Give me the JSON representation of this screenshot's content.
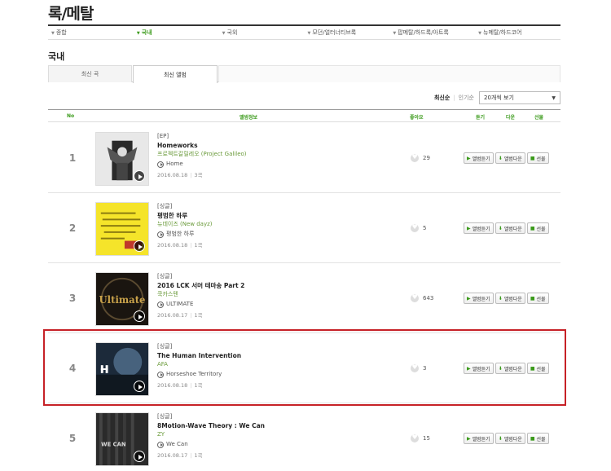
{
  "page_title": "록/메탈",
  "genre_nav": [
    "종합",
    "국내",
    "국외",
    "모던/얼터너티브록",
    "팝메탈/하드록/아트록",
    "뉴메탈/하드코어"
  ],
  "section_title": "국내",
  "tabs": [
    "최신 곡",
    "최신 앨범"
  ],
  "sort": {
    "newest": "최신순",
    "popular": "인기순",
    "view_select": "20개씩 보기"
  },
  "table_head": {
    "no": "No",
    "album_info": "앨범정보",
    "like": "좋아요",
    "listen": "듣기",
    "download": "다운",
    "gift": "선물"
  },
  "buttons": {
    "listen": "앨범듣기",
    "download": "앨범다운",
    "gift": "선물"
  },
  "albums": [
    {
      "no": "1",
      "type": "[EP]",
      "title": "Homeworks",
      "artist": "프로젝트갈릴레오 (Project Galileo)",
      "track": "Home",
      "date": "2016.08.18",
      "count": "3곡",
      "likes": "29"
    },
    {
      "no": "2",
      "type": "[싱글]",
      "title": "평범한 하루",
      "artist": "뉴데이즈 (New dayz)",
      "track": "평범한 하루",
      "date": "2016.08.18",
      "count": "1곡",
      "likes": "5"
    },
    {
      "no": "3",
      "type": "[싱글]",
      "title": "2016 LCK 서머 테마송 Part 2",
      "artist": "쿡카스텐",
      "track": "ULTIMATE",
      "date": "2016.08.17",
      "count": "1곡",
      "likes": "643"
    },
    {
      "no": "4",
      "type": "[싱글]",
      "title": "The Human Intervention",
      "artist": "AFA",
      "track": "Horseshoe Territory",
      "date": "2016.08.18",
      "count": "1곡",
      "likes": "3"
    },
    {
      "no": "5",
      "type": "[싱글]",
      "title": "8Motion-Wave Theory : We Can",
      "artist": "ZY",
      "track": "We Can",
      "date": "2016.08.17",
      "count": "1곡",
      "likes": "15"
    }
  ],
  "cover_text": {
    "c3": "Ultimate",
    "c5": "WE CAN"
  },
  "colors": {
    "accent": "#3a9a1a",
    "highlight": "#c62127"
  }
}
